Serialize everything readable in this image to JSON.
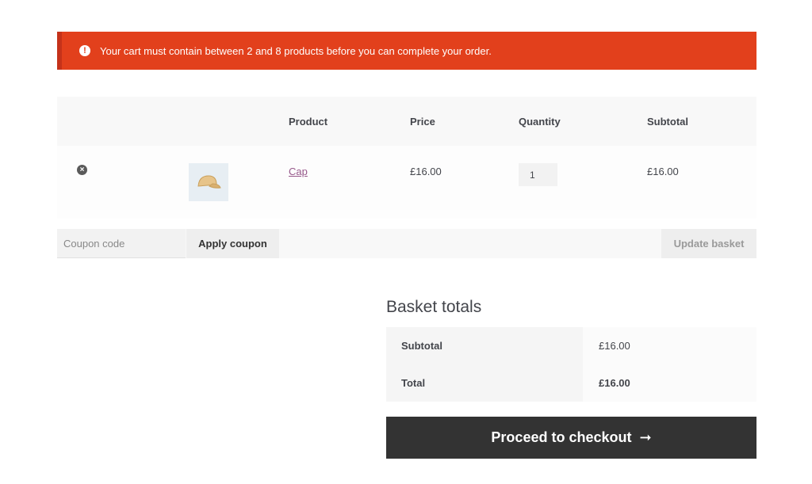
{
  "notice": {
    "icon": "info-icon",
    "message": "Your cart must contain between 2 and 8 products before you can complete your order."
  },
  "cart": {
    "headers": {
      "product": "Product",
      "price": "Price",
      "quantity": "Quantity",
      "subtotal": "Subtotal"
    },
    "items": [
      {
        "name": "Cap",
        "price": "£16.00",
        "quantity": "1",
        "subtotal": "£16.00"
      }
    ]
  },
  "actions": {
    "coupon_placeholder": "Coupon code",
    "apply_label": "Apply coupon",
    "update_label": "Update basket"
  },
  "totals": {
    "title": "Basket totals",
    "subtotal_label": "Subtotal",
    "subtotal_value": "£16.00",
    "total_label": "Total",
    "total_value": "£16.00"
  },
  "checkout": {
    "label": "Proceed to checkout"
  },
  "colors": {
    "notice": "#e2401c",
    "checkout": "#333333",
    "link": "#96588a"
  }
}
